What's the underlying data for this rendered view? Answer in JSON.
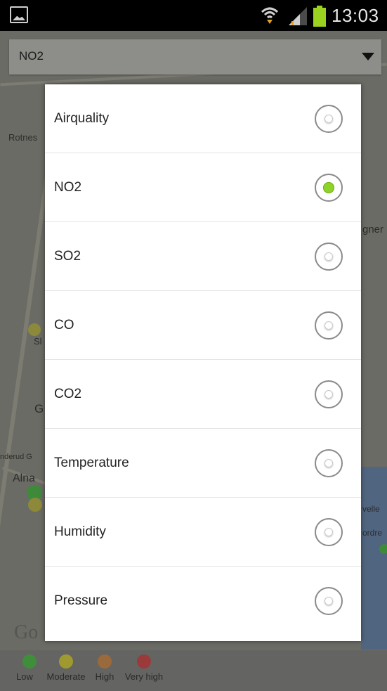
{
  "status_bar": {
    "time": "13:03"
  },
  "dropdown": {
    "selected": "NO2"
  },
  "map": {
    "labels": [
      "Rotnes",
      "gner",
      "Sl",
      "G",
      "nderud G",
      "Alna",
      "velle",
      "ordre",
      "Go"
    ]
  },
  "dialog": {
    "options": [
      {
        "label": "Airquality",
        "checked": false
      },
      {
        "label": "NO2",
        "checked": true
      },
      {
        "label": "SO2",
        "checked": false
      },
      {
        "label": "CO",
        "checked": false
      },
      {
        "label": "CO2",
        "checked": false
      },
      {
        "label": "Temperature",
        "checked": false
      },
      {
        "label": "Humidity",
        "checked": false
      },
      {
        "label": "Pressure",
        "checked": false
      }
    ]
  },
  "legend": {
    "items": [
      {
        "label": "Low",
        "color": "#3f8f3a"
      },
      {
        "label": "Moderate",
        "color": "#9f9a2f"
      },
      {
        "label": "High",
        "color": "#9a6a3c"
      },
      {
        "label": "Very high",
        "color": "#9b3a3a"
      }
    ]
  }
}
